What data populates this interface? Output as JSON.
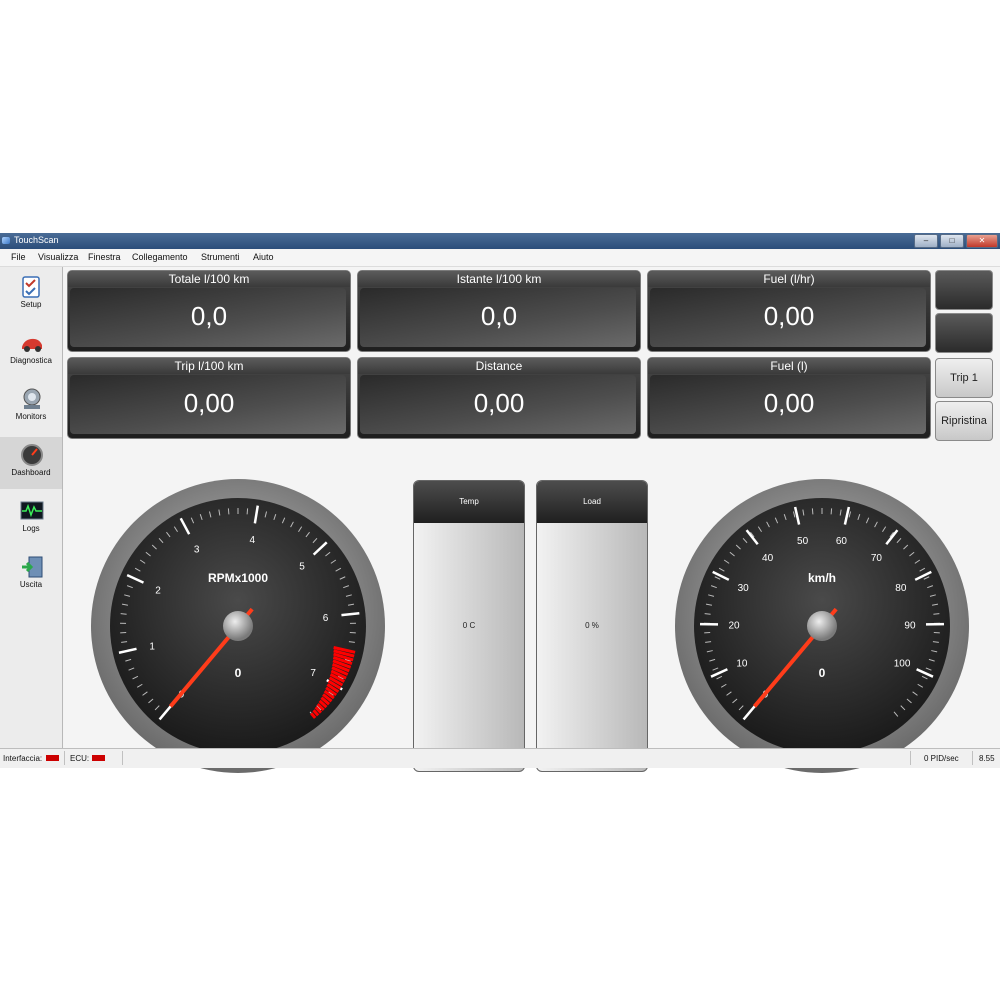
{
  "window": {
    "title": "TouchScan",
    "controls": [
      "–",
      "□",
      "✕"
    ]
  },
  "menu": [
    "File",
    "Visualizza",
    "Finestra",
    "Collegamento",
    "Strumenti",
    "Aiuto"
  ],
  "sidebar": [
    {
      "label": "Setup",
      "icon": "setup-icon"
    },
    {
      "label": "Diagnostica",
      "icon": "car-icon"
    },
    {
      "label": "Monitors",
      "icon": "monitor-icon"
    },
    {
      "label": "Dashboard",
      "icon": "speedometer-icon"
    },
    {
      "label": "Logs",
      "icon": "graph-icon"
    },
    {
      "label": "Uscita",
      "icon": "exit-icon"
    }
  ],
  "tiles": [
    {
      "label": "Totale l/100 km",
      "value": "0,0"
    },
    {
      "label": "Istante l/100 km",
      "value": "0,0"
    },
    {
      "label": "Fuel (l/hr)",
      "value": "0,00"
    },
    {
      "label": "Trip l/100 km",
      "value": "0,00"
    },
    {
      "label": "Distance",
      "value": "0,00"
    },
    {
      "label": "Fuel (l)",
      "value": "0,00"
    }
  ],
  "buttons": {
    "trip": "Trip 1",
    "reset": "Ripristina"
  },
  "bars": [
    {
      "label": "Temp",
      "value": "0 C"
    },
    {
      "label": "Load",
      "value": "0 %"
    }
  ],
  "rpm_gauge": {
    "unit": "RPMx1000",
    "value": "0",
    "ticks": [
      "0",
      "1",
      "2",
      "3",
      "4",
      "5",
      "6",
      "7"
    ],
    "max": 7.5,
    "redline": 6.5
  },
  "speed_gauge": {
    "unit": "km/h",
    "value": "0",
    "ticks": [
      "0",
      "10",
      "20",
      "30",
      "40",
      "50",
      "60",
      "70",
      "80",
      "90",
      "100"
    ],
    "max": 110
  },
  "status": {
    "interface_label": "Interfaccia:",
    "ecu_label": "ECU:",
    "pid_rate": "0 PID/sec",
    "version": "8.55"
  },
  "colors": {
    "accent": "#ff3c1a",
    "status_led": "#cc0000"
  }
}
